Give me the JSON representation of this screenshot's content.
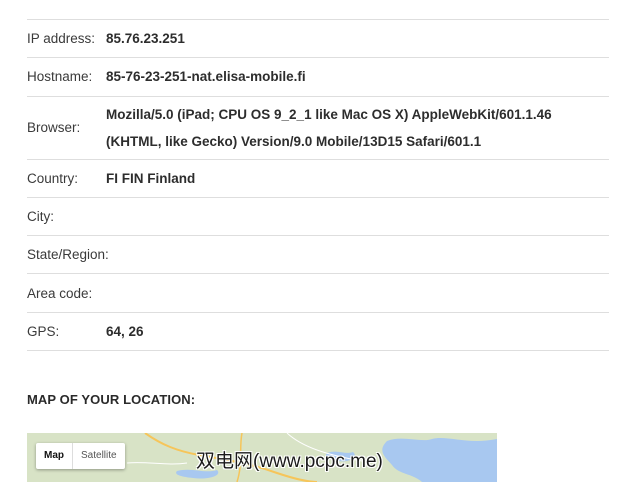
{
  "rows": [
    {
      "label": "IP address:",
      "value": "85.76.23.251"
    },
    {
      "label": "Hostname:",
      "value": "85-76-23-251-nat.elisa-mobile.fi"
    },
    {
      "label": "Browser:",
      "value": "Mozilla/5.0 (iPad; CPU OS 9_2_1 like Mac OS X) AppleWebKit/601.1.46 (KHTML, like Gecko) Version/9.0 Mobile/13D15 Safari/601.1"
    },
    {
      "label": "Country:",
      "value": "FI FIN Finland"
    },
    {
      "label": "City:",
      "value": ""
    },
    {
      "label": "State/Region:",
      "value": ""
    },
    {
      "label": "Area code:",
      "value": ""
    },
    {
      "label": "GPS:",
      "value": "64, 26"
    }
  ],
  "map_section": {
    "title": "MAP OF YOUR LOCATION:",
    "map_button": "Map",
    "satellite_button": "Satellite",
    "colors": {
      "land": "#d8e3c6",
      "water": "#a8c8f0",
      "road": "#f6c55a"
    }
  },
  "watermark": "双电网(www.pcpc.me)"
}
